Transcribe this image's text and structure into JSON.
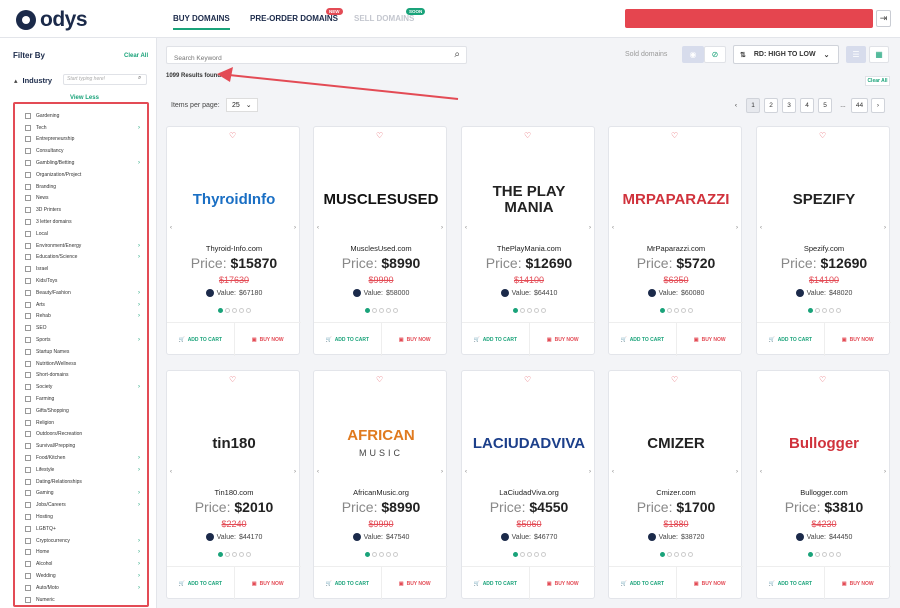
{
  "header": {
    "logo_text": "odys",
    "nav": [
      {
        "label": "BUY DOMAINS"
      },
      {
        "label": "PRE-ORDER DOMAINS",
        "badge": "NEW"
      },
      {
        "label": "SELL DOMAINS",
        "badge": "SOON"
      }
    ],
    "colors": {
      "accent": "#1aa37a",
      "danger": "#e34b55",
      "brand": "#1b2a4a"
    }
  },
  "sidebar": {
    "title": "Filter By",
    "clear_all": "Clear All",
    "industry_label": "Industry",
    "industry_search_placeholder": "Start typing here!",
    "view_less": "View Less",
    "categories": [
      {
        "label": "Gardening",
        "chevron": false
      },
      {
        "label": "Tech",
        "chevron": true
      },
      {
        "label": "Entrepreneurship",
        "chevron": false
      },
      {
        "label": "Consultancy",
        "chevron": false
      },
      {
        "label": "Gambling/Betting",
        "chevron": true
      },
      {
        "label": "Organization/Project",
        "chevron": false
      },
      {
        "label": "Branding",
        "chevron": false
      },
      {
        "label": "News",
        "chevron": false
      },
      {
        "label": "3D Printers",
        "chevron": false
      },
      {
        "label": "3 letter domains",
        "chevron": false
      },
      {
        "label": "Local",
        "chevron": false
      },
      {
        "label": "Environment/Energy",
        "chevron": true
      },
      {
        "label": "Education/Science",
        "chevron": true
      },
      {
        "label": "Israel",
        "chevron": false
      },
      {
        "label": "Kids/Toys",
        "chevron": false
      },
      {
        "label": "Beauty/Fashion",
        "chevron": true
      },
      {
        "label": "Arts",
        "chevron": true
      },
      {
        "label": "Rehab",
        "chevron": true
      },
      {
        "label": "SEO",
        "chevron": false
      },
      {
        "label": "Sports",
        "chevron": true
      },
      {
        "label": "Startup Names",
        "chevron": false
      },
      {
        "label": "Nutrition/Wellness",
        "chevron": false
      },
      {
        "label": "Short-domains",
        "chevron": false
      },
      {
        "label": "Society",
        "chevron": true
      },
      {
        "label": "Farming",
        "chevron": false
      },
      {
        "label": "Gifts/Shopping",
        "chevron": false
      },
      {
        "label": "Religion",
        "chevron": false
      },
      {
        "label": "Outdoors/Recreation",
        "chevron": false
      },
      {
        "label": "Survival/Prepping",
        "chevron": false
      },
      {
        "label": "Food/Kitchen",
        "chevron": true
      },
      {
        "label": "Lifestyle",
        "chevron": true
      },
      {
        "label": "Dating/Relationships",
        "chevron": false
      },
      {
        "label": "Gaming",
        "chevron": true
      },
      {
        "label": "Jobs/Careers",
        "chevron": true
      },
      {
        "label": "Hosting",
        "chevron": false
      },
      {
        "label": "LGBTQ+",
        "chevron": false
      },
      {
        "label": "Cryptocurrency",
        "chevron": true
      },
      {
        "label": "Home",
        "chevron": true
      },
      {
        "label": "Alcohol",
        "chevron": true
      },
      {
        "label": "Wedding",
        "chevron": true
      },
      {
        "label": "Auto/Moto",
        "chevron": true
      },
      {
        "label": "Numeric",
        "chevron": false
      }
    ]
  },
  "toolbar": {
    "search_placeholder": "Search Keyword",
    "sold_label": "Sold domains",
    "sort_label": "RD: HIGH TO LOW",
    "results_text": "1099 Results found",
    "clear_all": "Clear All",
    "ipp_label": "Items per page:",
    "ipp_value": "25"
  },
  "pagination": {
    "prev": "‹",
    "pages": [
      "1",
      "2",
      "3",
      "4",
      "5"
    ],
    "dots": "...",
    "last": "44",
    "next": "›",
    "current": "1"
  },
  "listing": {
    "price_label": "Price:",
    "value_label": "Value:",
    "add_to_cart": "ADD TO CART",
    "buy_now": "BUY NOW"
  },
  "cards": [
    {
      "domain": "Thyroid-Info.com",
      "price": "$15870",
      "old_price": "$17630",
      "value": "$67180",
      "logo_text": "ThyroidInfo",
      "logo_color": "#1a6fc4"
    },
    {
      "domain": "MusclesUsed.com",
      "price": "$8990",
      "old_price": "$9990",
      "value": "$58000",
      "logo_text": "MUSCLESUSED",
      "logo_color": "#111111"
    },
    {
      "domain": "ThePlayMania.com",
      "price": "$12690",
      "old_price": "$14100",
      "value": "$64410",
      "logo_text": "THE PLAY MANIA",
      "logo_color": "#222222"
    },
    {
      "domain": "MrPaparazzi.com",
      "price": "$5720",
      "old_price": "$6350",
      "value": "$60080",
      "logo_text": "MRPAPARAZZI",
      "logo_color": "#d0323c"
    },
    {
      "domain": "Spezify.com",
      "price": "$12690",
      "old_price": "$14100",
      "value": "$48020",
      "logo_text": "SPEZIFY",
      "logo_color": "#222222"
    },
    {
      "domain": "Tin180.com",
      "price": "$2010",
      "old_price": "$2240",
      "value": "$44170",
      "logo_text": "tin180",
      "logo_color": "#222222"
    },
    {
      "domain": "AfricanMusic.org",
      "price": "$8990",
      "old_price": "$9990",
      "value": "$47540",
      "logo_text": "AFRICAN",
      "logo_sub": "MUSIC",
      "logo_color": "#e07a1f"
    },
    {
      "domain": "LaCiudadViva.org",
      "price": "$4550",
      "old_price": "$5060",
      "value": "$46770",
      "logo_text": "LACIUDADVIVA",
      "logo_color": "#1c3f8a"
    },
    {
      "domain": "Cmizer.com",
      "price": "$1700",
      "old_price": "$1880",
      "value": "$38720",
      "logo_text": "CMIZER",
      "logo_color": "#222222"
    },
    {
      "domain": "Bullogger.com",
      "price": "$3810",
      "old_price": "$4230",
      "value": "$44450",
      "logo_text": "Bullogger",
      "logo_color": "#d0323c"
    }
  ]
}
